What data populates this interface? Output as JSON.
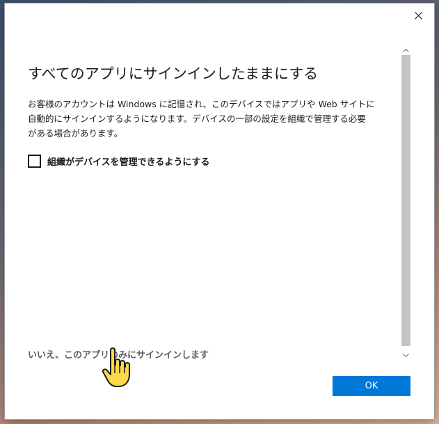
{
  "dialog": {
    "title": "すべてのアプリにサインインしたままにする",
    "description_lines": [
      "お客様のアカウントは Windows に記憶され、このデバイスではアプリや Web サイトに",
      "自動的にサインインするようになります。デバイスの一部の設定を組織で管理する必要",
      "がある場合があります。"
    ],
    "checkbox": {
      "label": "組織がデバイスを管理できるようにする",
      "checked": false
    },
    "link": "いいえ、このアプリのみにサインインします",
    "ok_label": "OK"
  },
  "colors": {
    "accent": "#0078d7",
    "text": "#1b1b1b",
    "link": "#5d5d5d",
    "scroll_thumb": "#c2c3c4"
  },
  "icons": {
    "close": "close-icon",
    "scroll_up": "chevron-up-icon",
    "scroll_down": "chevron-down-icon",
    "pointer": "hand-pointer-icon"
  }
}
